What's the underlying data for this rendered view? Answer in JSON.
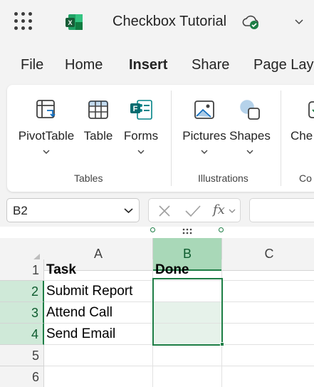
{
  "app": {
    "document_title": "Checkbox Tutorial"
  },
  "menu": {
    "tabs": [
      "File",
      "Home",
      "Insert",
      "Share",
      "Page Layo"
    ],
    "active": "Insert"
  },
  "ribbon": {
    "buttons": [
      {
        "label": "PivotTable",
        "icon": "pivot-table-icon"
      },
      {
        "label": "Table",
        "icon": "table-icon"
      },
      {
        "label": "Forms",
        "icon": "forms-icon"
      },
      {
        "label": "Pictures",
        "icon": "pictures-icon"
      },
      {
        "label": "Shapes",
        "icon": "shapes-icon"
      },
      {
        "label": "Che",
        "icon": "checkbox-icon"
      }
    ],
    "groups": [
      "Tables",
      "Illustrations",
      "Co"
    ]
  },
  "formula_bar": {
    "name_box": "B2",
    "fx_label": "fx",
    "formula": ""
  },
  "sheet": {
    "columns": [
      "A",
      "B",
      "C"
    ],
    "rows": [
      "1",
      "2",
      "3",
      "4",
      "5",
      "6"
    ],
    "cells": {
      "A1": "Task",
      "B1": "Done",
      "A2": "Submit Report",
      "A3": "Attend Call",
      "A4": "Send Email"
    },
    "selected_range": "B2:B4",
    "accent_color": "#1e7e46"
  }
}
